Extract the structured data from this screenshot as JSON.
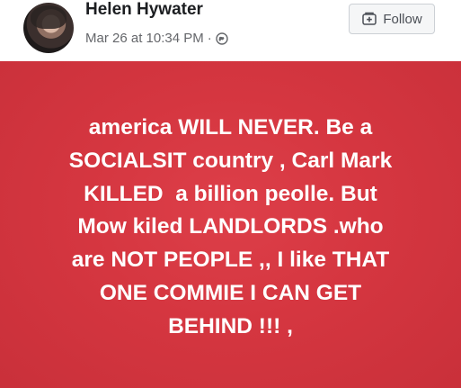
{
  "post": {
    "author_name": "Helen Hywater",
    "timestamp": "Mar 26 at 10:34 PM",
    "separator": "·",
    "privacy_icon": "globe-icon",
    "follow_label": "Follow",
    "follow_icon": "follow-add-icon",
    "background_color": "#d53640",
    "text_color": "#ffffff",
    "lines": [
      "america WILL NEVER. Be a",
      "SOCIALSIT country , Carl Mark",
      "KILLED  a billion peolle. But",
      "Mow kiled LANDLORDS .who",
      "are NOT PEOPLE ,, I like THAT",
      "ONE COMMIE I CAN GET",
      "BEHIND !!! ,"
    ]
  }
}
